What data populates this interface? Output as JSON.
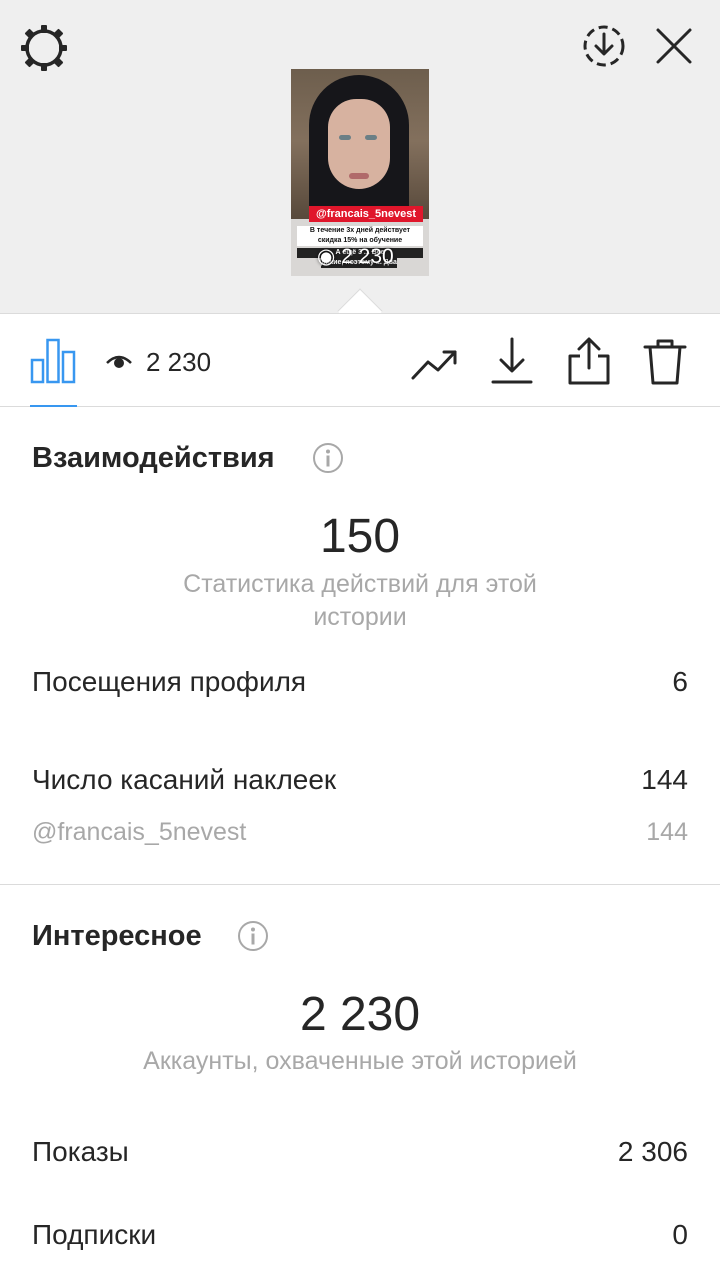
{
  "story_preview": {
    "sticker_text": "@francais_5nevest",
    "caption_lines": [
      "В течение 3х дней действует",
      "скидка 15% на обучение",
      "А ещё 3 ... Все",
      "дикие, поэтому ... Два раза дловняшки!"
    ],
    "views_overlay": "2 230"
  },
  "toolbar": {
    "views_count": "2 230"
  },
  "interactions": {
    "title": "Взаимодействия",
    "total": "150",
    "caption": "Статистика действий для этой истории",
    "rows": [
      {
        "label": "Посещения профиля",
        "value": "6"
      },
      {
        "label": "Число касаний наклеек",
        "value": "144"
      }
    ],
    "sticker_row": {
      "label": "@francais_5nevest",
      "value": "144"
    }
  },
  "discovery": {
    "title": "Интересное",
    "total": "2 230",
    "caption": "Аккаунты, охваченные этой историей",
    "rows": [
      {
        "label": "Показы",
        "value": "2 306"
      },
      {
        "label": "Подписки",
        "value": "0"
      }
    ]
  },
  "colors": {
    "accent": "#3897f0",
    "muted_text": "#a8a8a8",
    "divider": "#dbdbdb",
    "top_background": "#efefef"
  },
  "icons": [
    "settings-icon",
    "save-story-icon",
    "close-icon",
    "bar-chart-icon",
    "eye-icon",
    "trend-icon",
    "download-icon",
    "share-icon",
    "trash-icon",
    "info-icon"
  ]
}
